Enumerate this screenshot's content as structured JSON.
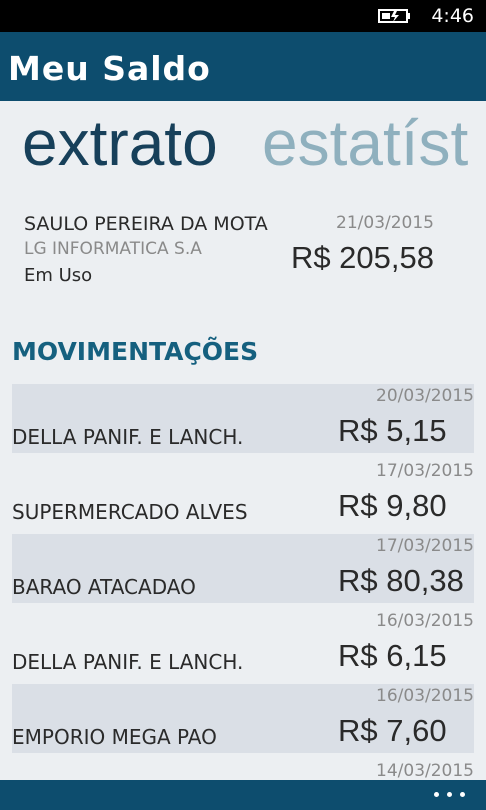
{
  "status_bar": {
    "time": "4:46",
    "battery_icon": "battery-charging-icon"
  },
  "header": {
    "title": "Meu Saldo"
  },
  "pivot": {
    "tabs": [
      {
        "label": "extrato",
        "active": true
      },
      {
        "label": "estatíst",
        "active": false
      }
    ]
  },
  "account": {
    "holder": "SAULO PEREIRA DA MOTA",
    "company": "LG INFORMATICA S.A",
    "status": "Em Uso",
    "date": "21/03/2015",
    "balance": "R$ 205,58"
  },
  "movements": {
    "title": "MOVIMENTAÇÕES",
    "items": [
      {
        "date": "20/03/2015",
        "description": "DELLA PANIF. E LANCH.",
        "amount": "R$ 5,15"
      },
      {
        "date": "17/03/2015",
        "description": "SUPERMERCADO ALVES",
        "amount": "R$ 9,80"
      },
      {
        "date": "17/03/2015",
        "description": "BARAO ATACADAO",
        "amount": "R$ 80,38"
      },
      {
        "date": "16/03/2015",
        "description": "DELLA PANIF. E LANCH.",
        "amount": "R$ 6,15"
      },
      {
        "date": "16/03/2015",
        "description": "EMPORIO MEGA PAO",
        "amount": "R$ 7,60"
      },
      {
        "date": "14/03/2015",
        "description": "",
        "amount": ""
      }
    ]
  },
  "app_bar": {
    "more_icon": "more-dots-icon"
  },
  "colors": {
    "header_bg": "#0d4d6e",
    "page_bg": "#eceff2",
    "row_shade": "#dadfe6",
    "section_title": "#15607f"
  }
}
